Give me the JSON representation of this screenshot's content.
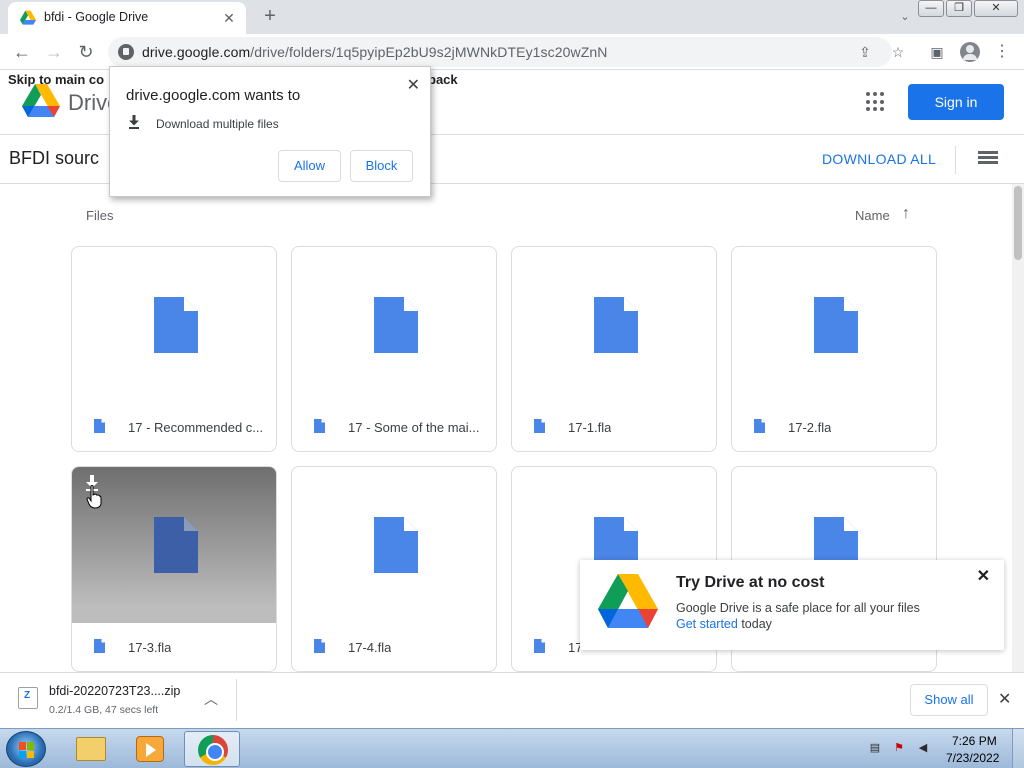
{
  "browser": {
    "tab_title": "bfdi - Google Drive",
    "tab_close": "✕",
    "new_tab": "+",
    "url_host": "drive.google.com",
    "url_path": "/drive/folders/1q5pyipEp2bU9s2jMWNkDTEy1sc20wZnN",
    "window_minimize": "—",
    "window_restore": "❐",
    "window_close": "✕"
  },
  "drive": {
    "skip_link": "Skip to main co",
    "go_back": "back",
    "product_name": "Drive",
    "sign_in": "Sign in",
    "folder_title": "BFDI sourc",
    "download_all": "DOWNLOAD ALL",
    "files_label": "Files",
    "sort_label": "Name",
    "sort_arrow": "↑",
    "files": [
      {
        "name": "17 - Recommended c..."
      },
      {
        "name": "17 - Some of the mai..."
      },
      {
        "name": "17-1.fla"
      },
      {
        "name": "17-2.fla"
      },
      {
        "name": "17-3.fla"
      },
      {
        "name": "17-4.fla"
      },
      {
        "name": "17"
      },
      {
        "name": ""
      }
    ]
  },
  "permission_popup": {
    "title": "drive.google.com wants to",
    "description": "Download multiple files",
    "close": "✕",
    "allow": "Allow",
    "block": "Block"
  },
  "promo": {
    "title": "Try Drive at no cost",
    "text": "Google Drive is a safe place for all your files",
    "link": "Get started",
    "after_link": " today",
    "close": "✕"
  },
  "download_shelf": {
    "file_name": "bfdi-20220723T23....zip",
    "status": "0.2/1.4 GB, 47 secs left",
    "show_all": "Show all",
    "close": "✕"
  },
  "taskbar": {
    "time": "7:26 PM",
    "date": "7/23/2022"
  },
  "colors": {
    "accent": "#1a73e8",
    "doc_icon": "#4a86e8",
    "doc_icon_selected": "#3c5fa8"
  },
  "icons": {
    "tab_favicon": "google-drive-icon",
    "back": "arrow-left-icon",
    "forward": "arrow-right-icon",
    "reload": "reload-icon",
    "lock": "lock-icon",
    "share": "share-icon",
    "bookmark": "star-icon",
    "side_panel": "side-panel-icon",
    "profile": "profile-icon",
    "menu": "kebab-menu-icon",
    "apps": "apps-grid-icon",
    "list_view": "list-view-icon",
    "file": "document-icon",
    "download": "download-icon",
    "zip": "zip-file-icon"
  }
}
